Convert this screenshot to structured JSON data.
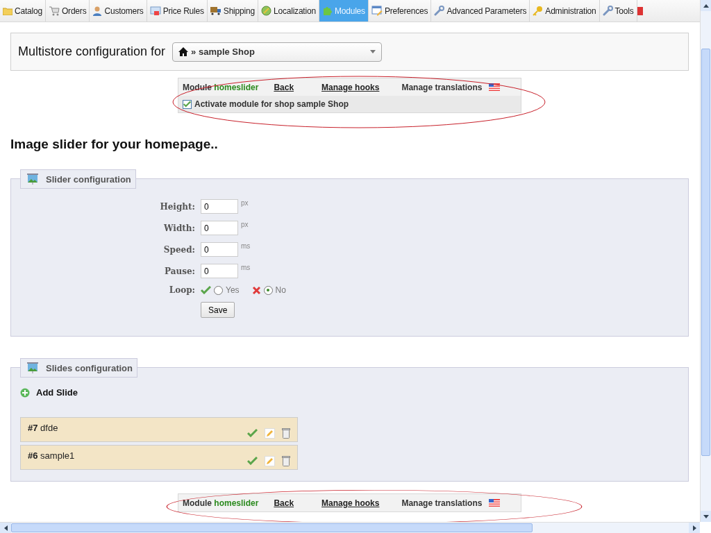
{
  "nav": {
    "tabs": [
      {
        "label": "Catalog",
        "selected": false
      },
      {
        "label": "Orders",
        "selected": false
      },
      {
        "label": "Customers",
        "selected": false
      },
      {
        "label": "Price Rules",
        "selected": false
      },
      {
        "label": "Shipping",
        "selected": false
      },
      {
        "label": "Localization",
        "selected": false
      },
      {
        "label": "Modules",
        "selected": true
      },
      {
        "label": "Preferences",
        "selected": false
      },
      {
        "label": "Advanced Parameters",
        "selected": false
      },
      {
        "label": "Administration",
        "selected": false
      },
      {
        "label": "Tools",
        "selected": false
      }
    ]
  },
  "multistore": {
    "label": "Multistore configuration for",
    "shop": "» sample Shop"
  },
  "module_toolbar_top": {
    "module_label": "Module",
    "module_name": "homeslider",
    "back": "Back",
    "manage_hooks": "Manage hooks",
    "manage_translations": "Manage translations",
    "activate_label": "Activate module for shop sample Shop",
    "activate_checked": true
  },
  "heading": "Image slider for your homepage..",
  "slider_config": {
    "title": "Slider configuration",
    "fields": [
      {
        "label": "Height:",
        "value": "0",
        "unit": "px"
      },
      {
        "label": "Width:",
        "value": "0",
        "unit": "px"
      },
      {
        "label": "Speed:",
        "value": "0",
        "unit": "ms"
      },
      {
        "label": "Pause:",
        "value": "0",
        "unit": "ms"
      }
    ],
    "loop": {
      "label": "Loop:",
      "options": [
        {
          "label": "Yes",
          "selected": false
        },
        {
          "label": "No",
          "selected": true
        }
      ]
    },
    "save": "Save"
  },
  "slides_config": {
    "title": "Slides configuration",
    "add": "Add Slide",
    "slides": [
      {
        "number": "#7",
        "name": "dfde",
        "active": true
      },
      {
        "number": "#6",
        "name": "sample1",
        "active": true
      }
    ]
  },
  "module_toolbar_bottom": {
    "module_label": "Module",
    "module_name": "homeslider",
    "back": "Back",
    "manage_hooks": "Manage hooks",
    "manage_translations": "Manage translations"
  }
}
